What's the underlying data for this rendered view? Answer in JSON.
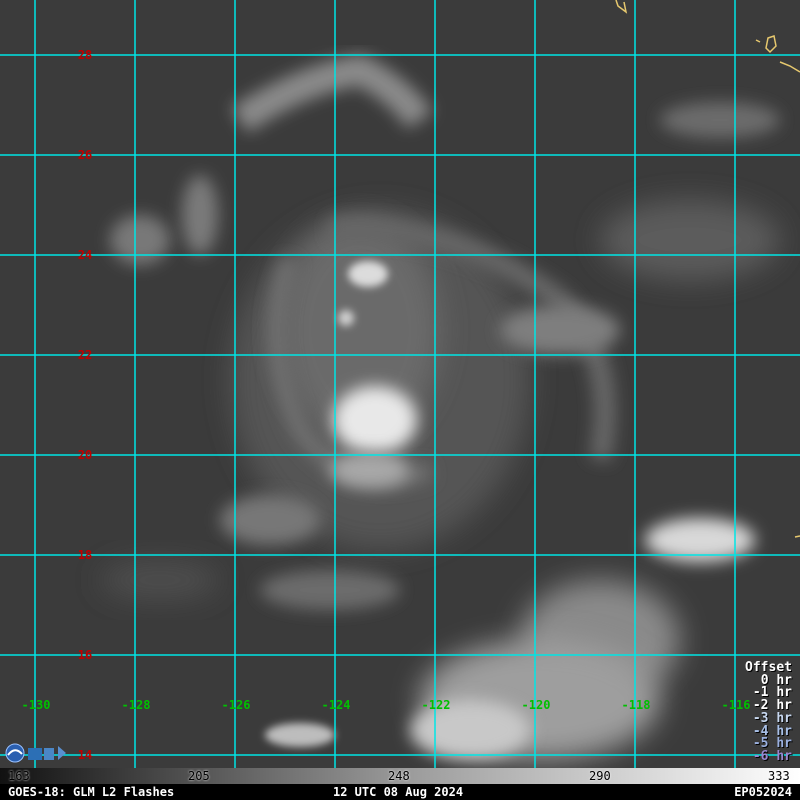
{
  "map": {
    "lat_labels": [
      "28",
      "26",
      "24",
      "22",
      "20",
      "18",
      "16",
      "14"
    ],
    "lon_labels": [
      "-130",
      "-128",
      "-126",
      "-124",
      "-122",
      "-120",
      "-118",
      "-116"
    ],
    "colors": {
      "grid": "#00e5e5",
      "lat_label": "#c00000",
      "lon_label": "#00c000",
      "coastline": "#e6c86e",
      "background": "#3a3a3a"
    }
  },
  "offset_legend": {
    "title": "Offset",
    "items": [
      {
        "label": "0 hr",
        "color": "#ffffff"
      },
      {
        "label": "-1 hr",
        "color": "#ffffff"
      },
      {
        "label": "-2 hr",
        "color": "#ffffff"
      },
      {
        "label": "-3 hr",
        "color": "#c8d8f0"
      },
      {
        "label": "-4 hr",
        "color": "#a8c0e8"
      },
      {
        "label": "-5 hr",
        "color": "#9ab0e0"
      },
      {
        "label": "-6 hr",
        "color": "#9a88d0"
      }
    ]
  },
  "colorbar": {
    "ticks": [
      "163",
      "205",
      "248",
      "290",
      "333"
    ]
  },
  "footer": {
    "left": "GOES-18: GLM L2 Flashes",
    "center": "12 UTC 08 Aug 2024",
    "right": "EP052024"
  }
}
